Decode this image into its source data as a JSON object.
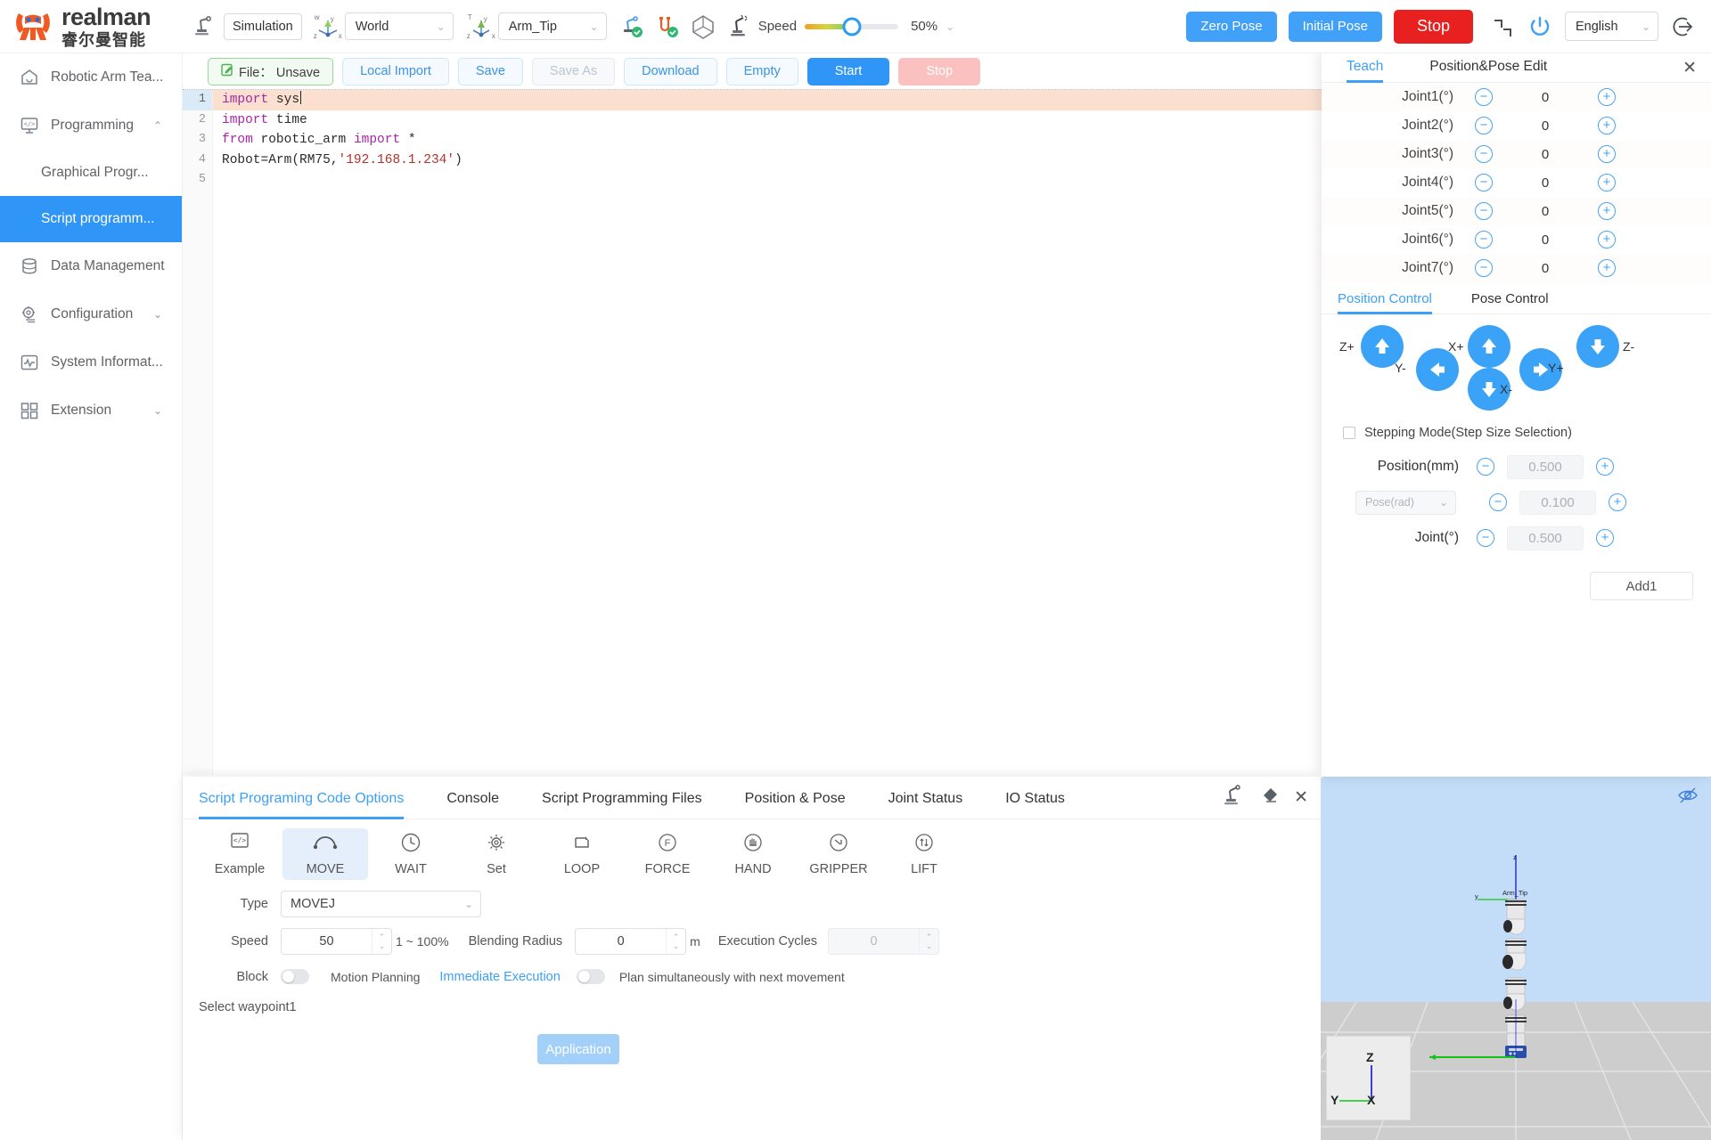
{
  "brand": {
    "name_en": "realman",
    "name_cn": "睿尔曼智能"
  },
  "topbar": {
    "mode_label": "Simulation",
    "frame_select": {
      "value": "World",
      "icon": "axis-world-icon"
    },
    "tool_select": {
      "value": "Arm_Tip",
      "icon": "axis-tool-icon"
    },
    "speed_label": "Speed",
    "speed_percent": "50%",
    "speed_value": 50,
    "zero_pose": "Zero Pose",
    "initial_pose": "Initial Pose",
    "stop": "Stop",
    "language": "English",
    "icons": [
      "robot-arm-icon",
      "robot-connected-icon",
      "io-connected-icon",
      "cube-icon",
      "motion-icon",
      "joint-limit-icon",
      "power-icon",
      "logout-icon"
    ]
  },
  "sidebar": {
    "items": [
      {
        "label": "Robotic Arm Tea...",
        "icon": "home-icon",
        "caret": ""
      },
      {
        "label": "Programming",
        "icon": "code-monitor-icon",
        "caret": "⌃"
      },
      {
        "label": "Data Management",
        "icon": "database-icon",
        "caret": ""
      },
      {
        "label": "Configuration",
        "icon": "gear-icon",
        "caret": "⌄"
      },
      {
        "label": "System Informat...",
        "icon": "pulse-icon",
        "caret": ""
      },
      {
        "label": "Extension",
        "icon": "grid-icon",
        "caret": "⌄"
      }
    ],
    "sub_items": [
      {
        "label": "Graphical Progr...",
        "active": false
      },
      {
        "label": "Script programm...",
        "active": true
      }
    ]
  },
  "filebar": {
    "file_chip": "File： Unsave",
    "file_icon": "edit-file-icon",
    "buttons": [
      {
        "label": "Local Import",
        "state": "normal"
      },
      {
        "label": "Save",
        "state": "normal"
      },
      {
        "label": "Save As",
        "state": "disabled"
      },
      {
        "label": "Download",
        "state": "normal"
      },
      {
        "label": "Empty",
        "state": "normal"
      },
      {
        "label": "Start",
        "state": "primary"
      },
      {
        "label": "Stop",
        "state": "danger"
      }
    ]
  },
  "editor": {
    "line_numbers": [
      "1",
      "2",
      "3",
      "4",
      "5"
    ],
    "lines": [
      {
        "n": "1",
        "highlight": true,
        "tokens": [
          {
            "t": "import",
            "c": "kw"
          },
          {
            "t": " sys",
            "c": ""
          }
        ]
      },
      {
        "n": "2",
        "highlight": false,
        "tokens": [
          {
            "t": "import",
            "c": "kw"
          },
          {
            "t": " time",
            "c": ""
          }
        ]
      },
      {
        "n": "3",
        "highlight": false,
        "tokens": [
          {
            "t": "from",
            "c": "kw"
          },
          {
            "t": " robotic_arm ",
            "c": ""
          },
          {
            "t": "import",
            "c": "kw"
          },
          {
            "t": " *",
            "c": ""
          }
        ]
      },
      {
        "n": "4",
        "highlight": false,
        "tokens": [
          {
            "t": "Robot=Arm(RM75,",
            "c": ""
          },
          {
            "t": "'192.168.1.234'",
            "c": "str"
          },
          {
            "t": ")",
            "c": ""
          }
        ]
      },
      {
        "n": "5",
        "highlight": false,
        "tokens": []
      }
    ]
  },
  "teach": {
    "tabs": [
      {
        "label": "Teach",
        "active": true
      },
      {
        "label": "Position&Pose Edit",
        "active": false
      }
    ],
    "close_icon": "close-icon",
    "joints": [
      {
        "name": "Joint1(°)",
        "value": "0"
      },
      {
        "name": "Joint2(°)",
        "value": "0"
      },
      {
        "name": "Joint3(°)",
        "value": "0"
      },
      {
        "name": "Joint4(°)",
        "value": "0"
      },
      {
        "name": "Joint5(°)",
        "value": "0"
      },
      {
        "name": "Joint6(°)",
        "value": "0"
      },
      {
        "name": "Joint7(°)",
        "value": "0"
      }
    ],
    "minus_icon": "minus-circle-icon",
    "plus_icon": "plus-circle-icon",
    "control_tabs": [
      {
        "label": "Position Control",
        "active": true
      },
      {
        "label": "Pose Control",
        "active": false
      }
    ],
    "jog": {
      "z_plus": "Z+",
      "z_minus": "Z-",
      "x_plus": "X+",
      "x_minus": "X-",
      "y_plus": "Y+",
      "y_minus": "Y-"
    },
    "stepping_label": "Stepping Mode(Step Size Selection)",
    "stepping_checked": false,
    "steps": [
      {
        "label": "Position(mm)",
        "value": "0.500",
        "type": "text"
      },
      {
        "label": "Pose(rad)",
        "value": "0.100",
        "type": "select"
      },
      {
        "label": "Joint(°)",
        "value": "0.500",
        "type": "text"
      }
    ],
    "add_button": "Add1"
  },
  "bottom": {
    "tabs": [
      {
        "label": "Script Programing Code Options",
        "active": true
      },
      {
        "label": "Console",
        "active": false
      },
      {
        "label": "Script Programming Files",
        "active": false
      },
      {
        "label": "Position & Pose",
        "active": false
      },
      {
        "label": "Joint Status",
        "active": false
      },
      {
        "label": "IO Status",
        "active": false
      }
    ],
    "panel_icons": [
      "teach-robot-icon",
      "eraser-icon",
      "close-icon"
    ],
    "commands": [
      {
        "label": "Example",
        "icon": "code-box-icon",
        "selected": false
      },
      {
        "label": "MOVE",
        "icon": "arc-move-icon",
        "selected": true
      },
      {
        "label": "WAIT",
        "icon": "clock-icon",
        "selected": false
      },
      {
        "label": "Set",
        "icon": "gear-icon",
        "selected": false
      },
      {
        "label": "LOOP",
        "icon": "loop-icon",
        "selected": false
      },
      {
        "label": "FORCE",
        "icon": "force-icon",
        "selected": false
      },
      {
        "label": "HAND",
        "icon": "hand-icon",
        "selected": false
      },
      {
        "label": "GRIPPER",
        "icon": "gripper-icon",
        "selected": false
      },
      {
        "label": "LIFT",
        "icon": "lift-icon",
        "selected": false
      }
    ],
    "form": {
      "type_label": "Type",
      "type_value": "MOVEJ",
      "speed_label": "Speed",
      "speed_value": "50",
      "speed_hint": "1 ~ 100%",
      "blending_label": "Blending Radius",
      "blending_value": "0",
      "blending_unit": "m",
      "cycles_label": "Execution Cycles",
      "cycles_value": "0",
      "block_label": "Block",
      "motion_planning_label": "Motion Planning",
      "immediate_execution_label": "Immediate Execution",
      "plan_label": "Plan simultaneously with next movement",
      "waypoint_label": "Select waypoint1",
      "apply_button": "Application"
    }
  },
  "view3d": {
    "arm_tip_label": "Arm_Tip",
    "gizmo_axes": {
      "z": "Z",
      "y": "Y",
      "x": "X"
    },
    "tip_axes": {
      "z": "z",
      "y": "y"
    },
    "eye_icon": "eye-off-icon",
    "sky_color": "#c3dcf7",
    "floor_color": "#cdcdcd"
  }
}
